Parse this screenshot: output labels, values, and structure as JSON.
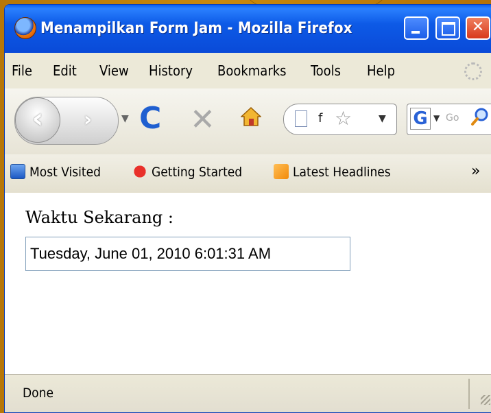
{
  "window": {
    "title": "Menampilkan Form Jam - Mozilla Firefox"
  },
  "menu": [
    "File",
    "Edit",
    "View",
    "History",
    "Bookmarks",
    "Tools",
    "Help"
  ],
  "navbar": {
    "url_text": "f",
    "search_placeholder": "Go"
  },
  "bookmarks": [
    {
      "label": "Most Visited",
      "icon": "most-visited-icon"
    },
    {
      "label": "Getting Started",
      "icon": "getting-started-icon"
    },
    {
      "label": "Latest Headlines",
      "icon": "rss-feed-icon"
    }
  ],
  "content": {
    "label": "Waktu Sekarang :",
    "time_value": "Tuesday, June 01, 2010 6:01:31 AM"
  },
  "status": "Done",
  "colors": {
    "titlebar": "#0a5ae6",
    "chrome": "#ece9d8",
    "close_button": "#d8381a",
    "slide_background": "#c9890c"
  }
}
